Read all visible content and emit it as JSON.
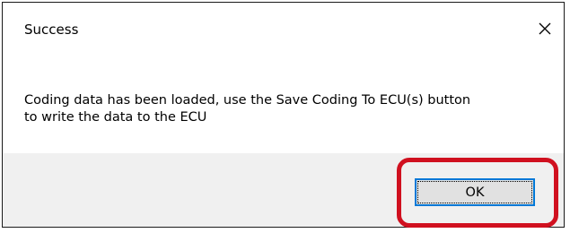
{
  "dialog": {
    "title": "Success",
    "message_line1": "Coding data has been loaded, use the Save Coding To ECU(s) button",
    "message_line2": "to write the data to the ECU",
    "ok_label": "OK",
    "close_icon": "close-icon"
  },
  "colors": {
    "accent": "#0078d7",
    "highlight": "#d0101f",
    "footer": "#f0f0f0",
    "button": "#e1e1e1"
  }
}
